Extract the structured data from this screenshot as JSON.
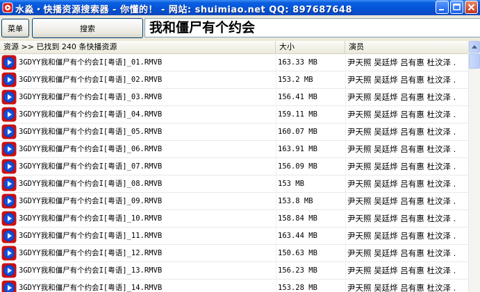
{
  "window": {
    "title": "水淼・快播资源搜索器 - 你懂的！ - 网站: shuimiao.net QQ: 897687648",
    "controls": [
      "minimize",
      "maximize",
      "close"
    ]
  },
  "toolbar": {
    "menu_label": "菜单",
    "search_label": "搜索",
    "search_value": "我和僵尸有个约会"
  },
  "list": {
    "columns": [
      "资源 >> 已找到 240 条快播资源",
      "大小",
      "演员"
    ],
    "rows": [
      {
        "name": "3GDYY我和僵尸有个约会I[粤语]_01.RMVB",
        "size": "163.33 MB",
        "cast": "尹天照 吴廷烨 吕有惠 杜汶泽 ."
      },
      {
        "name": "3GDYY我和僵尸有个约会I[粤语]_02.RMVB",
        "size": "153.2 MB",
        "cast": "尹天照 吴廷烨 吕有惠 杜汶泽 ."
      },
      {
        "name": "3GDYY我和僵尸有个约会I[粤语]_03.RMVB",
        "size": "156.41 MB",
        "cast": "尹天照 吴廷烨 吕有惠 杜汶泽 ."
      },
      {
        "name": "3GDYY我和僵尸有个约会I[粤语]_04.RMVB",
        "size": "159.11 MB",
        "cast": "尹天照 吴廷烨 吕有惠 杜汶泽 ."
      },
      {
        "name": "3GDYY我和僵尸有个约会I[粤语]_05.RMVB",
        "size": "160.07 MB",
        "cast": "尹天照 吴廷烨 吕有惠 杜汶泽 ."
      },
      {
        "name": "3GDYY我和僵尸有个约会I[粤语]_06.RMVB",
        "size": "163.91 MB",
        "cast": "尹天照 吴廷烨 吕有惠 杜汶泽 ."
      },
      {
        "name": "3GDYY我和僵尸有个约会I[粤语]_07.RMVB",
        "size": "156.09 MB",
        "cast": "尹天照 吴廷烨 吕有惠 杜汶泽 ."
      },
      {
        "name": "3GDYY我和僵尸有个约会I[粤语]_08.RMVB",
        "size": "153 MB",
        "cast": "尹天照 吴廷烨 吕有惠 杜汶泽 ."
      },
      {
        "name": "3GDYY我和僵尸有个约会I[粤语]_09.RMVB",
        "size": "153.8 MB",
        "cast": "尹天照 吴廷烨 吕有惠 杜汶泽 ."
      },
      {
        "name": "3GDYY我和僵尸有个约会I[粤语]_10.RMVB",
        "size": "158.84 MB",
        "cast": "尹天照 吴廷烨 吕有惠 杜汶泽 ."
      },
      {
        "name": "3GDYY我和僵尸有个约会I[粤语]_11.RMVB",
        "size": "163.44 MB",
        "cast": "尹天照 吴廷烨 吕有惠 杜汶泽 ."
      },
      {
        "name": "3GDYY我和僵尸有个约会I[粤语]_12.RMVB",
        "size": "150.63 MB",
        "cast": "尹天照 吴廷烨 吕有惠 杜汶泽 ."
      },
      {
        "name": "3GDYY我和僵尸有个约会I[粤语]_13.RMVB",
        "size": "156.23 MB",
        "cast": "尹天照 吴廷烨 吕有惠 杜汶泽 ."
      },
      {
        "name": "3GDYY我和僵尸有个约会I[粤语]_14.RMVB",
        "size": "153.28 MB",
        "cast": "尹天照 吴廷烨 吕有惠 杜汶泽 ."
      }
    ]
  },
  "colors": {
    "titlebar": "#0553d6",
    "row_icon_red": "#cc1010",
    "row_icon_blue": "#0b3fbf"
  },
  "icons": {
    "app": "app-logo-icon",
    "row": "kuaibo-play-icon"
  }
}
